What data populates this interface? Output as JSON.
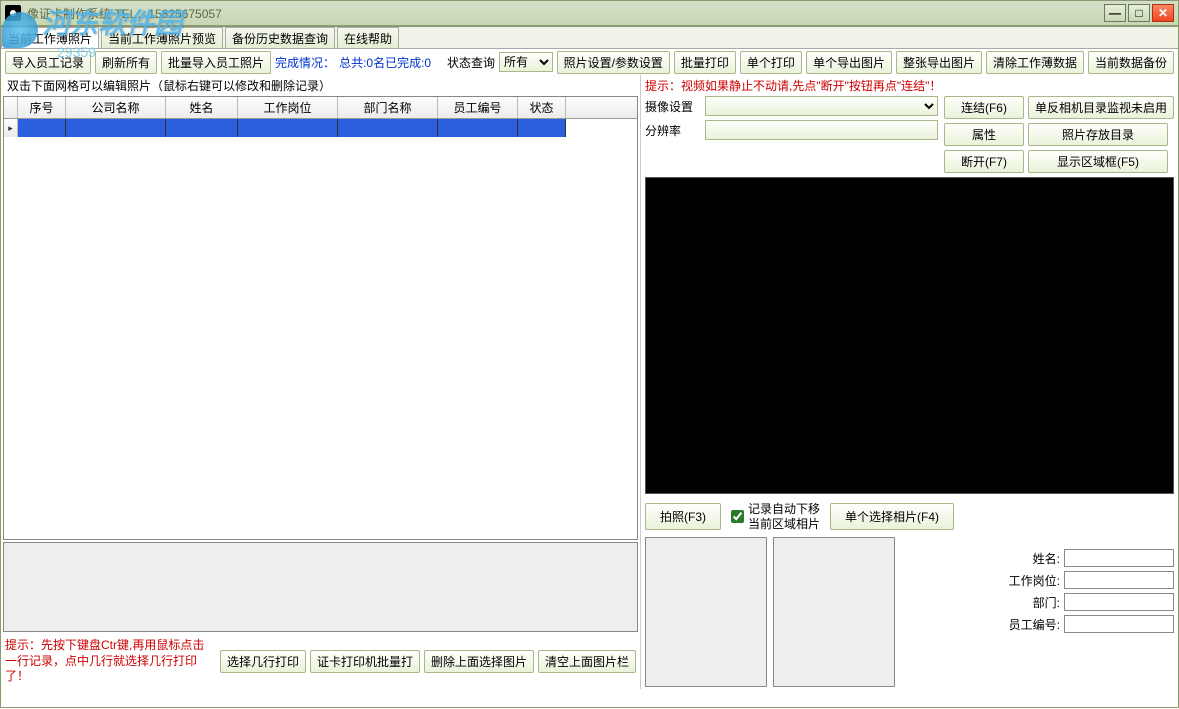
{
  "window": {
    "title": "像证卡制作系统 TEL：15825675057"
  },
  "tabs": {
    "t1": "当前工作薄照片",
    "t2": "当前工作薄照片预览",
    "t3": "备份历史数据查询",
    "t4": "在线帮助"
  },
  "toolbar": {
    "import": "导入员工记录",
    "refresh": "刷新所有",
    "batch_import": "批量导入员工照片",
    "complete_label": "完成情况：",
    "complete_stat": "总共:0名已完成:0",
    "status_query": "状态查询",
    "status_value": "所有",
    "photo_settings": "照片设置/参数设置",
    "batch_print": "批量打印",
    "single_print": "单个打印",
    "single_export": "单个导出图片",
    "full_export": "整张导出图片",
    "clear_workbook": "清除工作薄数据",
    "backup": "当前数据备份"
  },
  "grid": {
    "edit_hint": "双击下面网格可以编辑照片（鼠标右键可以修改和删除记录）",
    "h0": "序号",
    "h1": "公司名称",
    "h2": "姓名",
    "h3": "工作岗位",
    "h4": "部门名称",
    "h5": "员工编号",
    "h6": "状态"
  },
  "bottom": {
    "hint": "提示：先按下键盘Ctr键,再用鼠标点击一行记录，点中几行就选择几行打印了！",
    "select_print": "选择几行打印",
    "card_batch": "证卡打印机批量打",
    "delete_sel": "删除上面选择图片",
    "clear_col": "清空上面图片栏"
  },
  "right": {
    "hint1": "提示：视频如果静止不动请,先点\"断开\"按钮再点\"连结\"！",
    "cam_label": "摄像设置",
    "res_label": "分辨率",
    "connect": "连结(F6)",
    "dslr": "单反相机目录监视未启用",
    "props": "属性",
    "photo_dir": "照片存放目录",
    "disconnect": "断开(F7)",
    "show_area": "显示区域框(F5)",
    "capture": "拍照(F3)",
    "auto_move": "记录自动下移",
    "area_photo": "当前区域相片",
    "single_sel": "单个选择相片(F4)",
    "f_name": "姓名:",
    "f_post": "工作岗位:",
    "f_dept": "部门:",
    "f_emp": "员工编号:"
  }
}
